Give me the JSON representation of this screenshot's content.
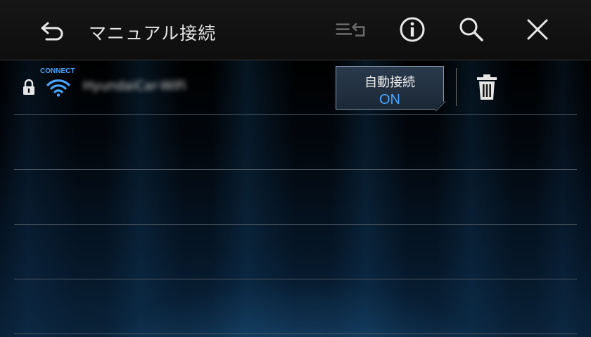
{
  "header": {
    "title": "マニュアル接続",
    "icons": [
      "back-icon",
      "list-return-icon",
      "info-icon",
      "search-icon",
      "close-icon"
    ]
  },
  "entries": [
    {
      "status_label": "CONNECT",
      "ssid": "HyundaiCar-WiFi",
      "secured": true,
      "auto_connect_label": "自動接続",
      "auto_connect_state": "ON"
    }
  ],
  "colors": {
    "accent": "#4aa6ff",
    "header_bg": "#141414",
    "text": "#e6e6e6",
    "divider": "#4a5560"
  }
}
